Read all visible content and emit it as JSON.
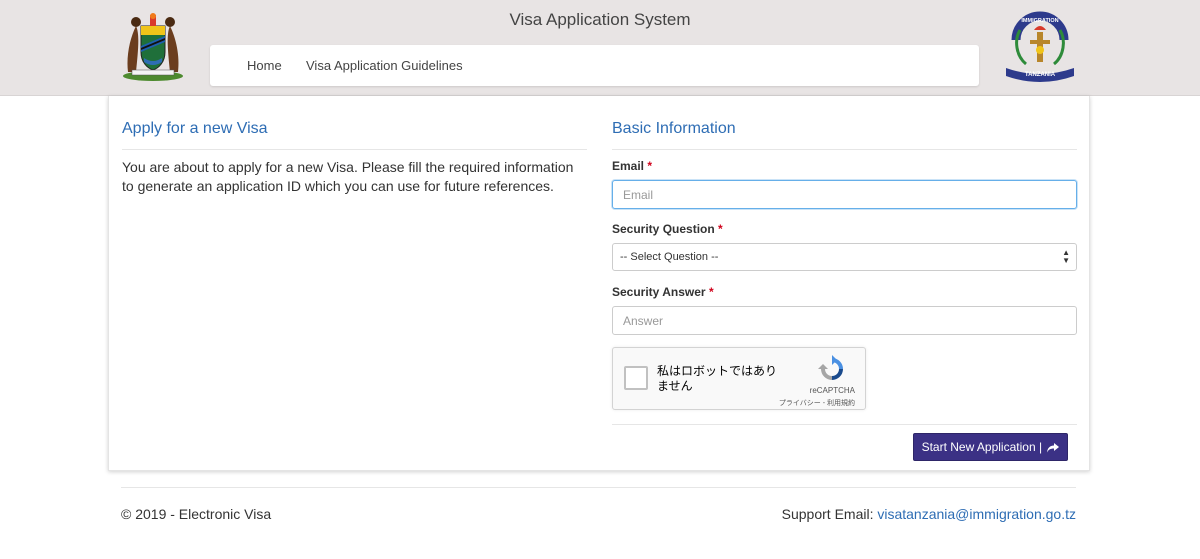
{
  "header": {
    "title": "Visa Application System",
    "left_logo_icon": "tanzania-coat-of-arms-icon",
    "right_logo_icon": "immigration-tanzania-logo-icon",
    "right_logo_text": "IMMIGRATION",
    "right_logo_subtext": "TANZANIA"
  },
  "nav": {
    "items": [
      {
        "label": "Home"
      },
      {
        "label": "Visa Application Guidelines"
      }
    ]
  },
  "left": {
    "title": "Apply for a new Visa",
    "intro": "You are about to apply for a new Visa. Please fill the required information to generate an application ID which you can use for future references."
  },
  "form": {
    "title": "Basic Information",
    "required_mark": "*",
    "email": {
      "label": "Email",
      "placeholder": "Email",
      "value": ""
    },
    "question": {
      "label": "Security Question",
      "selected": "-- Select Question --"
    },
    "answer": {
      "label": "Security Answer",
      "placeholder": "Answer",
      "value": ""
    },
    "captcha": {
      "text": "私はロボットではありません",
      "brand": "reCAPTCHA",
      "links": "プライバシー - 利用規約",
      "icon": "recaptcha-icon"
    },
    "submit": {
      "label": "Start New Application |",
      "icon": "share-arrow-icon"
    }
  },
  "footer": {
    "copyright": "© 2019 - Electronic Visa",
    "support_label": "Support Email:",
    "support_email": "visatanzania@immigration.go.tz"
  },
  "colors": {
    "header_bg": "#e8e4e4",
    "accent_blue": "#2e6db4",
    "button_bg": "#3b3185",
    "required_red": "#d0021b"
  }
}
